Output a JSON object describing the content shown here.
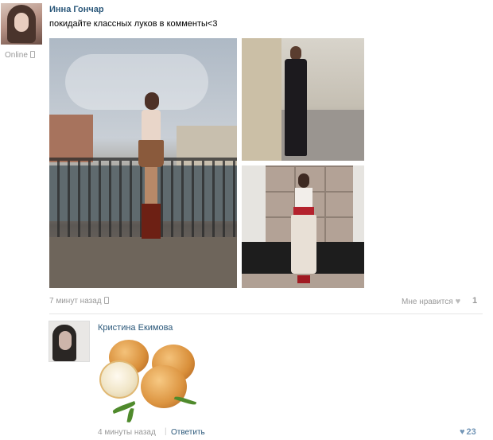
{
  "post": {
    "author": "Инна Гончар",
    "status": "Online",
    "text": "покидайте классных луков в комменты<3",
    "time": "7 минут назад",
    "like_label": "Мне нравится",
    "like_count": "1"
  },
  "comment": {
    "author": "Кристина Екимова",
    "time": "4 минуты назад",
    "separator": "|",
    "reply_label": "Ответить",
    "like_count": "23"
  },
  "icons": {
    "heart": "♥",
    "phone": "phone-icon"
  },
  "colors": {
    "link": "#2b587a",
    "muted": "#999999",
    "like_active": "#7396b7"
  }
}
